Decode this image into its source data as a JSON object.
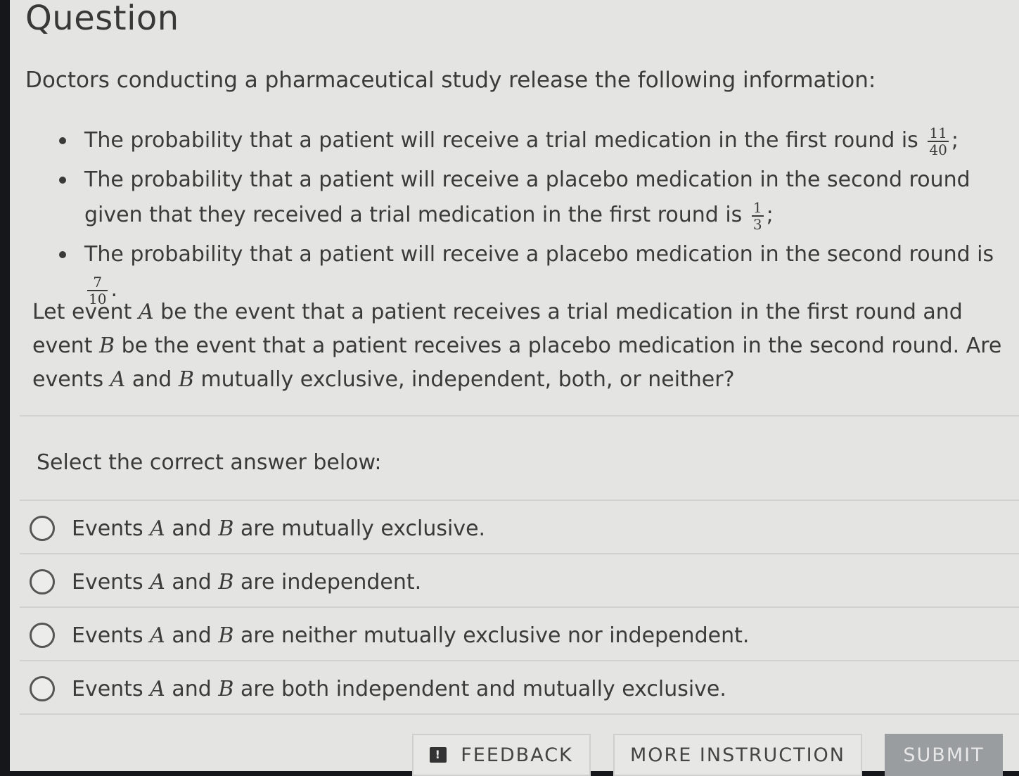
{
  "question": {
    "title": "Question",
    "intro": "Doctors conducting a pharmaceutical study release the following information:",
    "bullets": [
      {
        "text": "The probability that a patient will receive a trial medication in the first round is",
        "num": "11",
        "den": "40",
        "suffix": ";"
      },
      {
        "text": "The probability that a patient will receive a placebo medication in the second round given that they received a trial medication in the first round is",
        "num": "1",
        "den": "3",
        "suffix": ";"
      },
      {
        "text": "The probability that a patient will receive a placebo medication in the second round is",
        "num": "7",
        "den": "10",
        "suffix": "."
      }
    ],
    "body": {
      "p1": "Let event",
      "var_a": "A",
      "p2": "be the event that a patient receives a trial medication in the first round and event",
      "var_b": "B",
      "p3": "be the event that a patient receives a placebo medication in the second round. Are events",
      "p4": "and",
      "p5": "mutually exclusive, independent, both, or neither?"
    }
  },
  "answers": {
    "prompt": "Select the correct answer below:",
    "word_events": "Events",
    "word_and": "and",
    "var_a": "A",
    "var_b": "B",
    "options": [
      {
        "rest": "are mutually exclusive."
      },
      {
        "rest": "are independent."
      },
      {
        "rest": "are neither mutually exclusive nor independent."
      },
      {
        "rest": "are both independent and mutually exclusive."
      }
    ]
  },
  "footer": {
    "feedback_icon": "!",
    "feedback_label": "FEEDBACK",
    "more_label": "MORE INSTRUCTION",
    "submit_label": "SUBMIT"
  }
}
